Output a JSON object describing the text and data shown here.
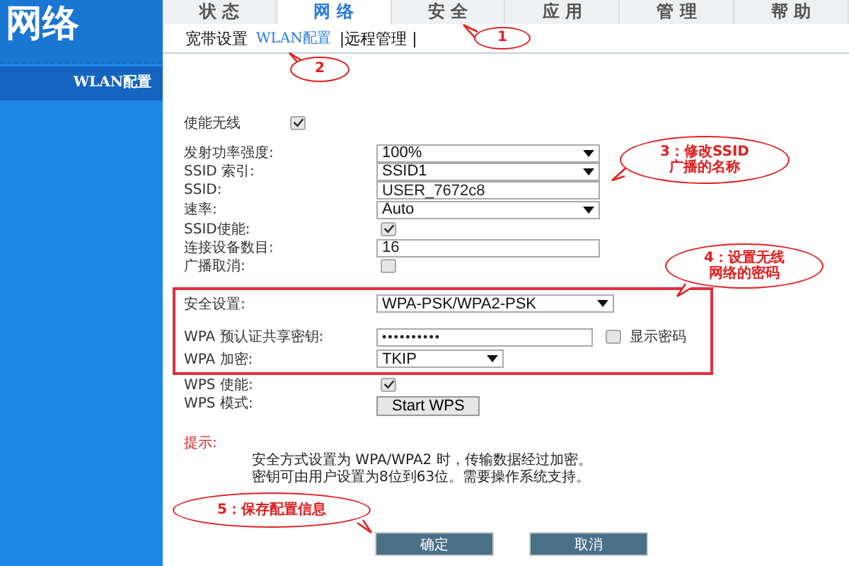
{
  "sidebar": {
    "heading": "网络",
    "items": [
      {
        "label": "WLAN配置",
        "selected": true
      }
    ]
  },
  "tabs": [
    {
      "label": "状 态",
      "selected": false
    },
    {
      "label": "网 络",
      "selected": true
    },
    {
      "label": "安 全",
      "selected": false
    },
    {
      "label": "应 用",
      "selected": false
    },
    {
      "label": "管 理",
      "selected": false
    },
    {
      "label": "帮 助",
      "selected": false
    }
  ],
  "subnav": [
    {
      "label": "宽带设置",
      "selected": false
    },
    {
      "label": "WLAN配置",
      "selected": true
    },
    {
      "label": "|远程管理 |",
      "selected": false
    }
  ],
  "form": {
    "top": [
      {
        "kind": "checkbox",
        "label": "使能无线",
        "checked": true
      }
    ],
    "rows": [
      {
        "kind": "select",
        "label": "发射功率强度:",
        "value": "100%"
      },
      {
        "kind": "select",
        "label": "SSID 索引:",
        "value": "SSID1"
      },
      {
        "kind": "text",
        "label": "SSID:",
        "value": "USER_7672c8"
      },
      {
        "kind": "select",
        "label": "速率:",
        "value": "Auto"
      },
      {
        "kind": "checkbox",
        "label": "SSID使能:",
        "checked": true
      },
      {
        "kind": "text",
        "label": "连接设备数目:",
        "value": "16"
      },
      {
        "kind": "checkbox",
        "label": "广播取消:",
        "checked": false
      }
    ],
    "security": [
      {
        "kind": "select",
        "label": "安全设置:",
        "value": "WPA-PSK/WPA2-PSK"
      },
      {
        "kind": "password",
        "label": "WPA 预认证共享密钥:",
        "value": "••••••••••",
        "show_label": "显示密码",
        "show_checked": false
      },
      {
        "kind": "select",
        "label": "WPA 加密:",
        "value": "TKIP"
      }
    ],
    "wps": [
      {
        "kind": "checkbox",
        "label": "WPS 使能:",
        "checked": true
      },
      {
        "kind": "button",
        "label": "WPS 模式:",
        "value": "Start WPS"
      }
    ]
  },
  "hint": {
    "title": "提示:",
    "lines": [
      "安全方式设置为 WPA/WPA2 时，传输数据经过加密。",
      "密钥可由用户设置为8位到63位。需要操作系统支持。"
    ]
  },
  "buttons": [
    "确定",
    "取消"
  ],
  "callouts": [
    {
      "text": "1"
    },
    {
      "text": "2"
    },
    {
      "text": "3：修改SSID广播的名称"
    },
    {
      "text": "4：设置无线网络的密码"
    },
    {
      "text": "5：保存配置信息"
    }
  ]
}
